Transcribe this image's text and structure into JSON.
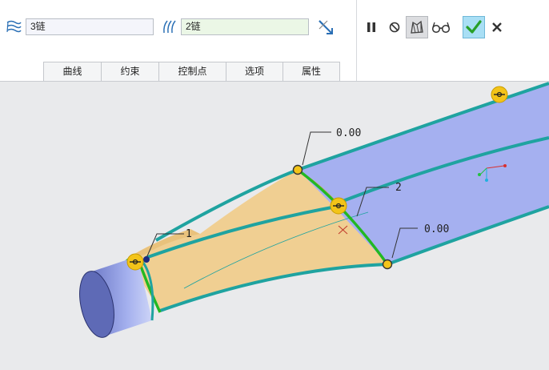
{
  "toolbar": {
    "chain1": {
      "value": "3链",
      "icon": "surface-chain-icon"
    },
    "chain2": {
      "value": "2链",
      "icon": "curve-chain-icon"
    },
    "swap_icon": "swap-direction-icon",
    "tabs": [
      "曲线",
      "约束",
      "控制点",
      "选项",
      "属性"
    ],
    "actions": {
      "pause_icon": "pause-icon",
      "no_preview_icon": "no-preview-icon",
      "preview_icon": "geometry-preview-icon",
      "verify_icon": "glasses-icon",
      "ok_icon": "checkmark-icon",
      "cancel_icon": "close-icon"
    }
  },
  "viewport": {
    "labels": {
      "top_value": "0.00",
      "right_value": "0.00",
      "mid_index": "2",
      "left_index": "1"
    },
    "colors": {
      "surface_blue": "#a5b0f0",
      "blend_surface": "#f0cf92",
      "edge_teal": "#1fa3a0",
      "boundary_green": "#22b822",
      "handle_yellow": "#f3c419",
      "ok_green": "#28a028"
    }
  }
}
